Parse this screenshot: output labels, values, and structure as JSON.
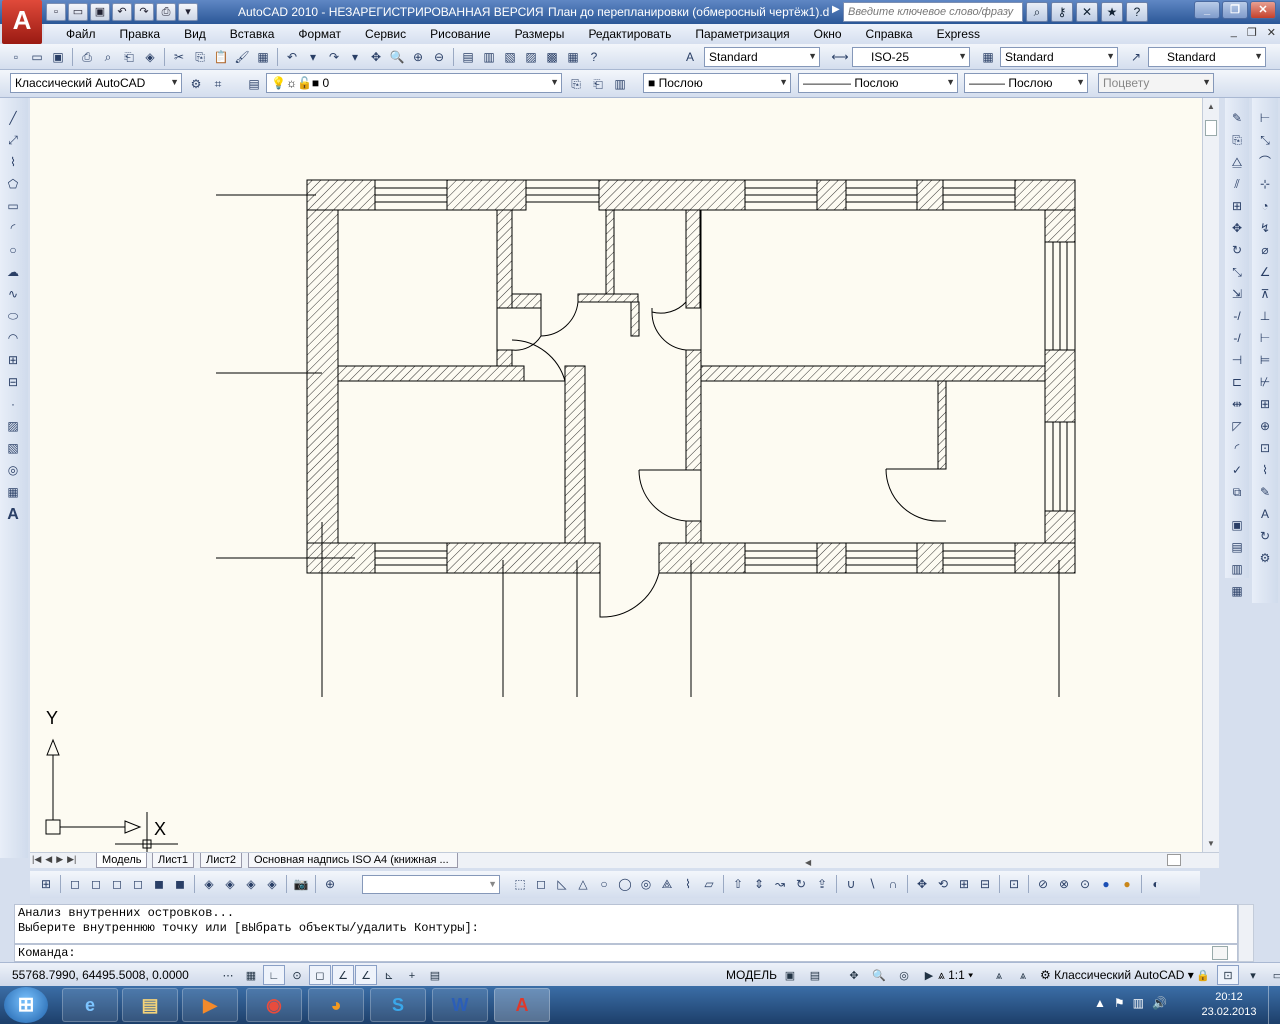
{
  "window": {
    "title": "AutoCAD 2010 - НЕЗАРЕГИСТРИРОВАННАЯ ВЕРСИЯ",
    "document": "План до перепланировки (обмеросный чертёж1).d",
    "search_placeholder": "Введите ключевое слово/фразу"
  },
  "menu": [
    "Файл",
    "Правка",
    "Вид",
    "Вставка",
    "Формат",
    "Сервис",
    "Рисование",
    "Размеры",
    "Редактировать",
    "Параметризация",
    "Окно",
    "Справка",
    "Express"
  ],
  "styles_toolbar": {
    "text_style": "Standard",
    "dim_style": "ISO-25",
    "table_style": "Standard",
    "mleader_style": "Standard"
  },
  "workspace_toolbar": {
    "workspace": "Классический AutoCAD",
    "layer": "0",
    "color": "Послою",
    "linetype": "Послою",
    "lineweight": "Послою",
    "plotstyle": "Поцвету"
  },
  "layout_tabs": [
    "Модель",
    "Лист1",
    "Лист2",
    "Основная надпись ISO A4 (книжная ..."
  ],
  "ucs": {
    "x_label": "X",
    "y_label": "Y"
  },
  "command": {
    "history": [
      "Анализ внутренних островков...",
      "Выберите внутреннюю точку или [вЫбрать объекты/удалить Контуры]:"
    ],
    "prompt": "Команда:"
  },
  "status": {
    "coords": "55768.7990, 64495.5008, 0.0000",
    "model": "МОДЕЛЬ",
    "scale": "1:1",
    "workspace": "Классический AutoCAD"
  },
  "taskbar": {
    "time": "20:12",
    "date": "23.02.2013",
    "apps": [
      "internet-explorer",
      "file-explorer",
      "media-player",
      "chrome",
      "firefox",
      "skype",
      "word",
      "autocad"
    ]
  },
  "colors": {
    "canvas": "#fdfbf2",
    "title_bar": "#2b5797",
    "accent_red": "#c8281c"
  }
}
